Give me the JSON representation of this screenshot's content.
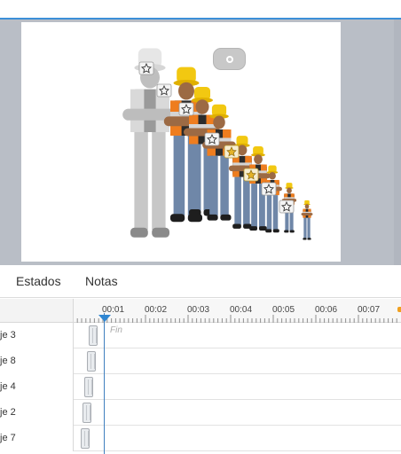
{
  "tabs": {
    "estados": "Estados",
    "notas": "Notas"
  },
  "timeline": {
    "ruler_labels": [
      "00:01",
      "00:02",
      "00:03",
      "00:04",
      "00:05",
      "00:06",
      "00:07"
    ],
    "end_label": "Fin",
    "rows": [
      {
        "label": "je 3"
      },
      {
        "label": "je 8"
      },
      {
        "label": "je 4"
      },
      {
        "label": "je 2"
      },
      {
        "label": "je 7"
      }
    ]
  },
  "icons": {
    "star": "star-icon",
    "record": "record-icon",
    "playhead": "playhead-icon"
  },
  "colors": {
    "accent": "#3c8fd8",
    "stage_bg": "#b9bec6",
    "helmet_yellow": "#f2c811",
    "vest_orange": "#ee7d1f",
    "playhead_blue": "#2f86d2"
  }
}
